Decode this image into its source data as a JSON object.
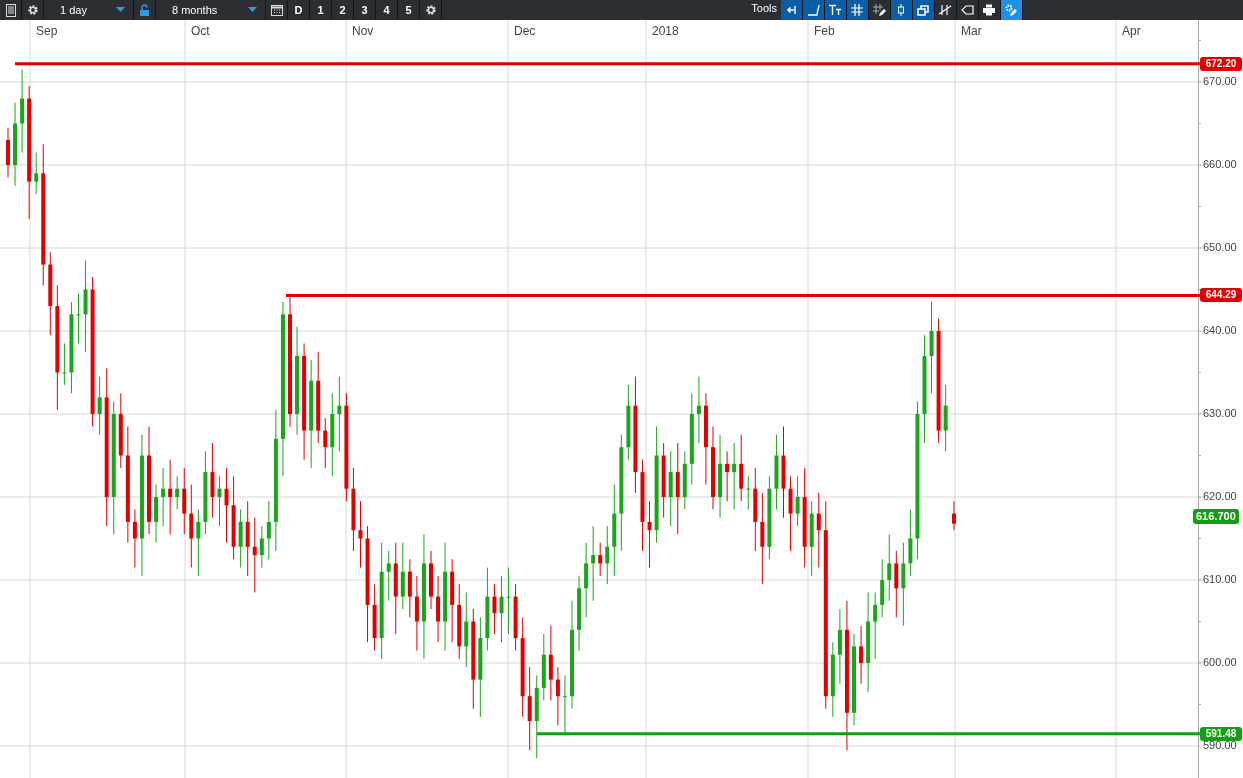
{
  "toolbar": {
    "interval": "1 day",
    "range": "8 months",
    "periods": [
      {
        "label": "D"
      },
      {
        "label": "1"
      },
      {
        "label": "2"
      },
      {
        "label": "3"
      },
      {
        "label": "4"
      },
      {
        "label": "5"
      }
    ],
    "tools_label": "Tools",
    "tools": [
      {
        "kind": "back",
        "on": true
      },
      {
        "kind": "curve",
        "on": true
      },
      {
        "kind": "text",
        "on": true
      },
      {
        "kind": "grid",
        "on": true
      },
      {
        "kind": "draw",
        "on": false
      },
      {
        "kind": "candle",
        "on": true
      },
      {
        "kind": "windows",
        "on": true
      },
      {
        "kind": "lines",
        "on": false
      },
      {
        "kind": "tag",
        "on": false
      },
      {
        "kind": "print",
        "on": false
      },
      {
        "kind": "settings",
        "on": true
      }
    ]
  },
  "chart": {
    "months": [
      "Sep",
      "Oct",
      "Nov",
      "Dec",
      "2018",
      "Feb",
      "Mar",
      "Apr"
    ],
    "y_ticks": [
      "670.00",
      "660.00",
      "650.00",
      "640.00",
      "630.00",
      "620.00",
      "610.00",
      "600.00",
      "590.00"
    ],
    "levels": [
      {
        "label": "672.20",
        "color": "#e00000"
      },
      {
        "label": "644.29",
        "color": "#e00000"
      },
      {
        "label": "591.48",
        "color": "#12a012"
      }
    ],
    "last_price": "616.700"
  }
}
